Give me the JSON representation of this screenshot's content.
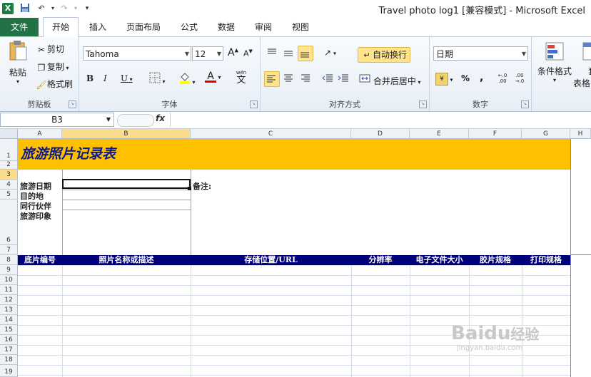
{
  "window": {
    "title": "Travel photo log1  [兼容模式]  -  Microsoft Excel"
  },
  "quick_access": {
    "app_icon": "excel-icon",
    "save_icon": "save-icon",
    "undo_icon": "undo-icon",
    "redo_icon": "redo-icon",
    "customize_icon": "chevron-down-icon"
  },
  "tabs": [
    "文件",
    "开始",
    "插入",
    "页面布局",
    "公式",
    "数据",
    "审阅",
    "视图"
  ],
  "ribbon": {
    "clipboard": {
      "paste": "粘贴",
      "cut": "剪切",
      "copy": "复制",
      "format_painter": "格式刷",
      "label": "剪贴板"
    },
    "font": {
      "name": "Tahoma",
      "size": "12",
      "bold": "B",
      "italic": "I",
      "underline": "U",
      "grow": "A",
      "shrink": "A",
      "color_letter": "A",
      "wen": "wén",
      "wen_char": "文",
      "label": "字体"
    },
    "alignment": {
      "wrap": "自动换行",
      "merge": "合并后居中",
      "label": "对齐方式"
    },
    "number": {
      "format": "日期",
      "percent": "%",
      "comma": ",",
      "inc": "+.0\n.00",
      "dec": ".00\n→.0",
      "label": "数字"
    },
    "styles": {
      "conditional": "条件格式",
      "table_partial": "套",
      "table_partial2": "表格"
    }
  },
  "formula_bar": {
    "name_box": "B3",
    "fx": "fx",
    "value": ""
  },
  "columns": [
    "A",
    "B",
    "C",
    "D",
    "E",
    "F",
    "G",
    "H"
  ],
  "rows": [
    "1",
    "2",
    "3",
    "4",
    "5",
    "6",
    "7",
    "8",
    "9",
    "10",
    "11",
    "12",
    "13",
    "14",
    "15",
    "16",
    "17",
    "18",
    "19"
  ],
  "sheet": {
    "title": "旅游照片记录表",
    "labels": {
      "date": "旅游日期",
      "dest": "目的地",
      "companions": "同行伙伴",
      "impression": "旅游印象",
      "notes": "备注:"
    },
    "headers": [
      "底片编号",
      "照片名称或描述",
      "存储位置/URL",
      "分辨率",
      "电子文件大小",
      "胶片规格",
      "打印规格"
    ]
  },
  "watermark": {
    "brand": "Baidu",
    "brand2": "经验",
    "url": "jingyan.baidu.com"
  },
  "colors": {
    "title_band": "#ffc000",
    "title_text": "#0b1a8a",
    "header_band": "#00007a",
    "file_tab": "#217346",
    "accent": "#ffe38d"
  }
}
